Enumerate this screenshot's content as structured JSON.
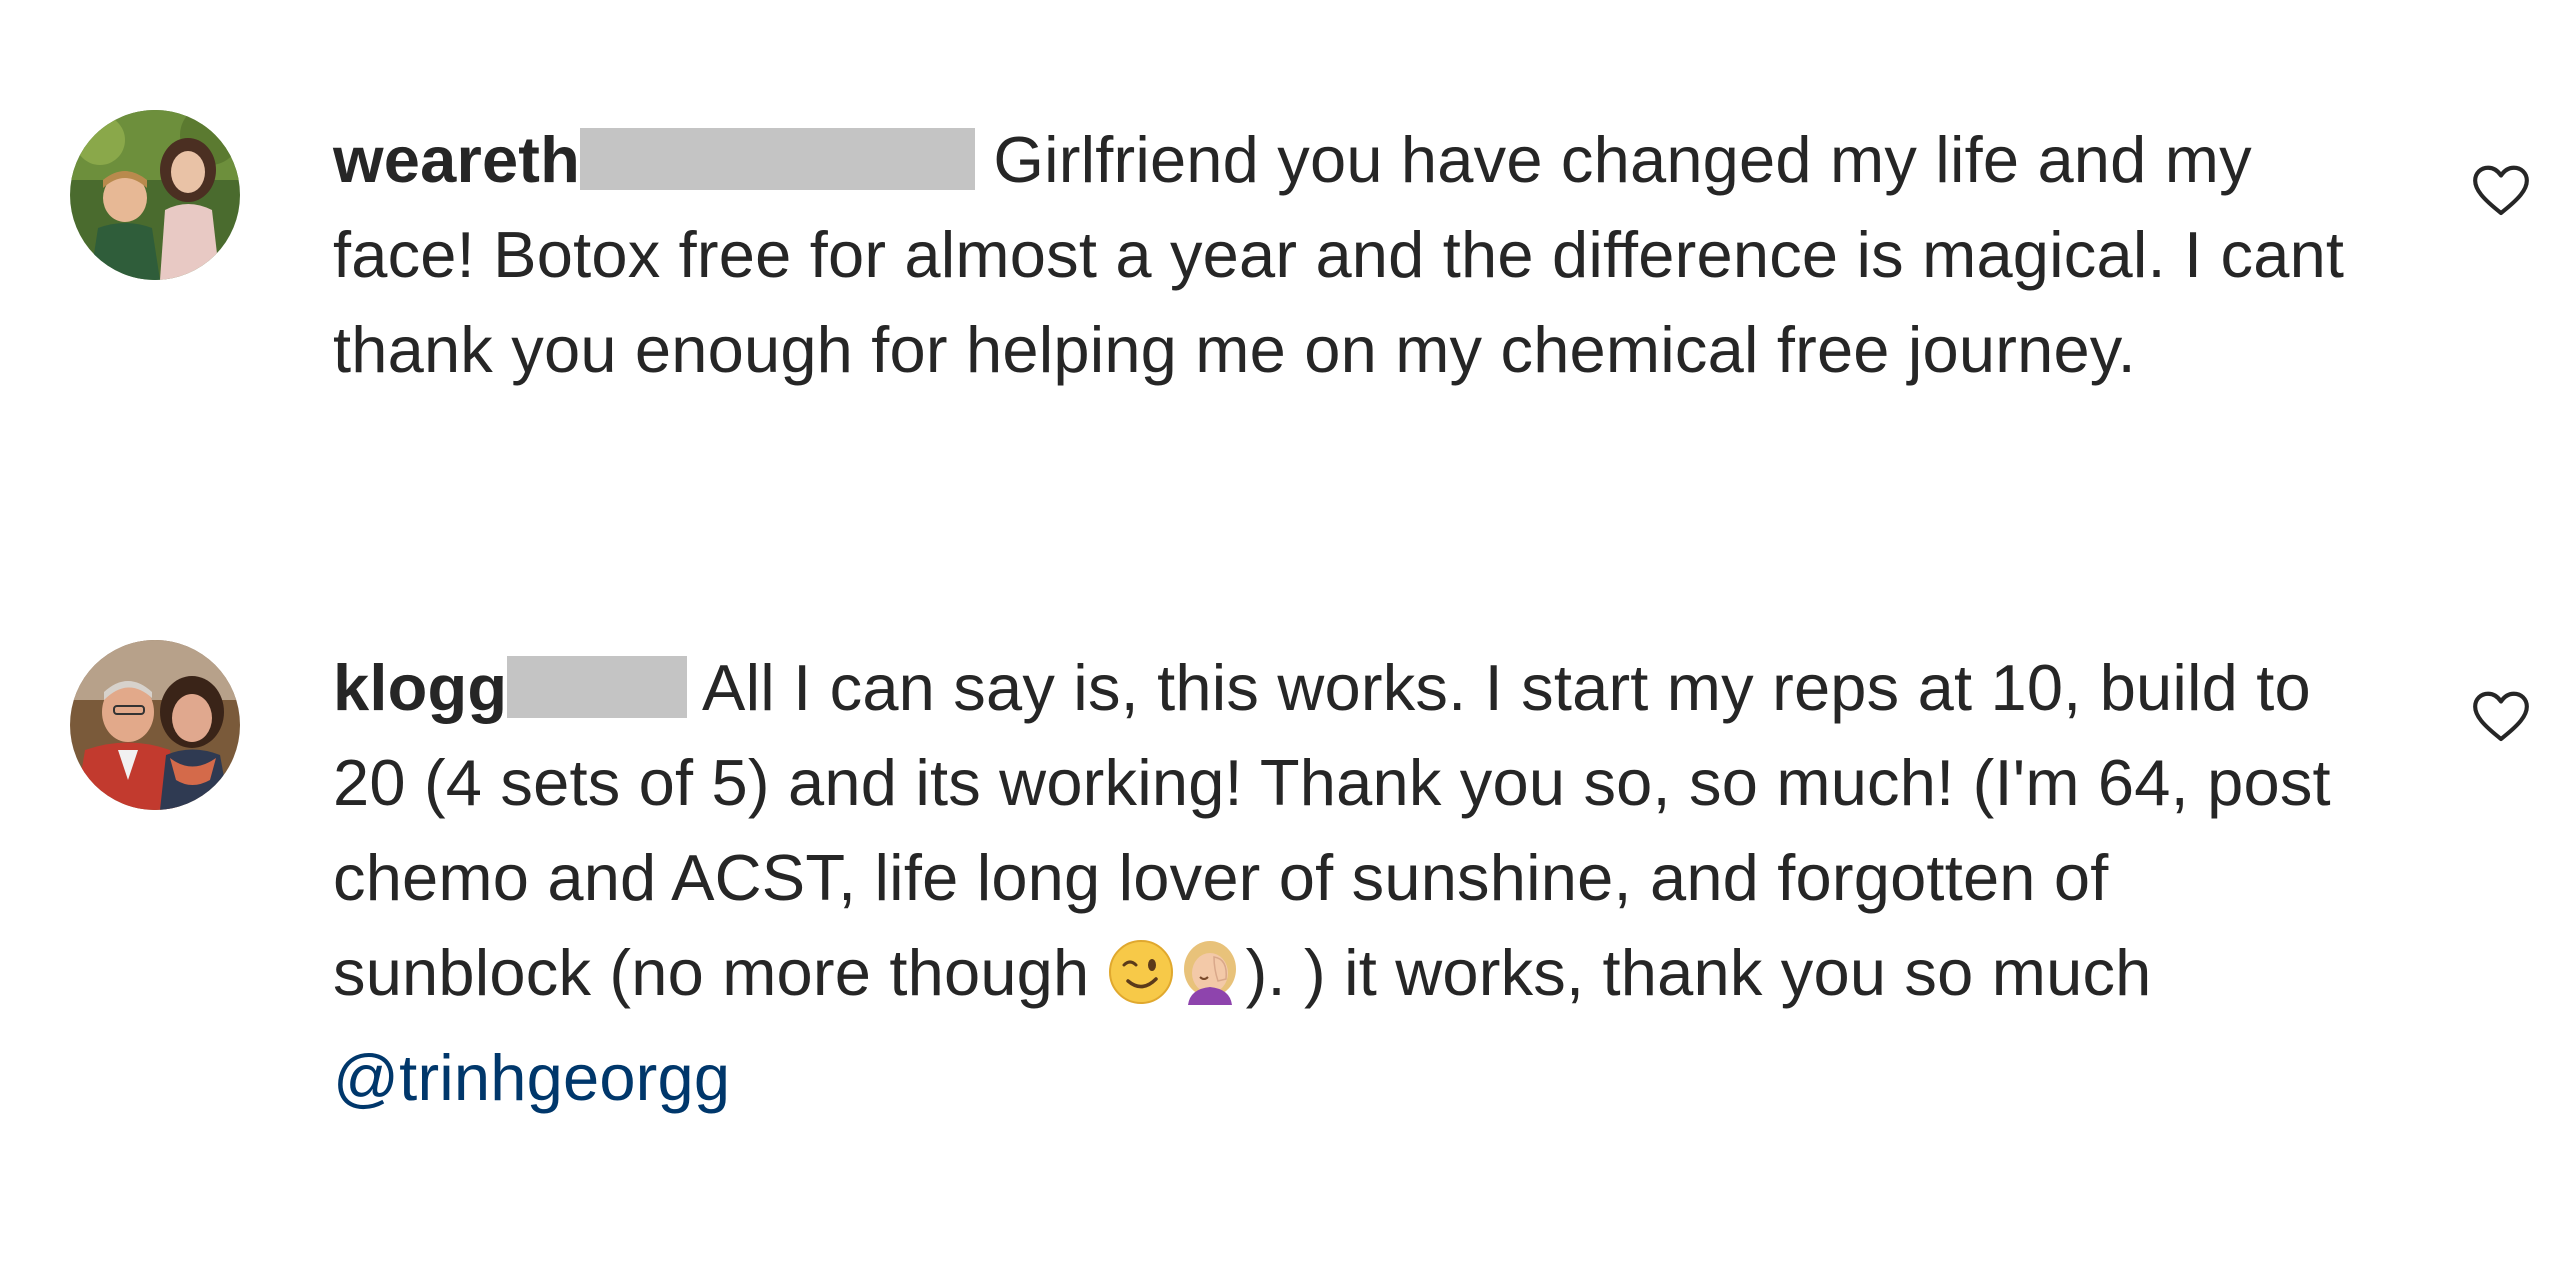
{
  "comments": [
    {
      "username": "weareth",
      "text": "Girlfriend you have changed my life and my face! Botox free for almost a year and the difference is magical. I cant thank you enough for helping me on my chemical free journey.",
      "like_icon": "heart-outline-icon"
    },
    {
      "username": "klogg",
      "text_part1": "All I can say is, this works. I start my reps at 10, build to 20 (4 sets of 5) and its working! Thank you so, so much! (I'm 64, post chemo and ACST, life long lover of sunshine, and forgotten of sunblock (no more though ",
      "text_part2": "). ) it works, thank you so much ",
      "mention": "@trinhgeorgg",
      "emojis": [
        "winking-face-emoji",
        "woman-facepalming-emoji"
      ],
      "like_icon": "heart-outline-icon"
    }
  ],
  "colors": {
    "text": "#262626",
    "mention": "#00376b",
    "redaction": "#c4c4c4",
    "background": "#ffffff"
  }
}
